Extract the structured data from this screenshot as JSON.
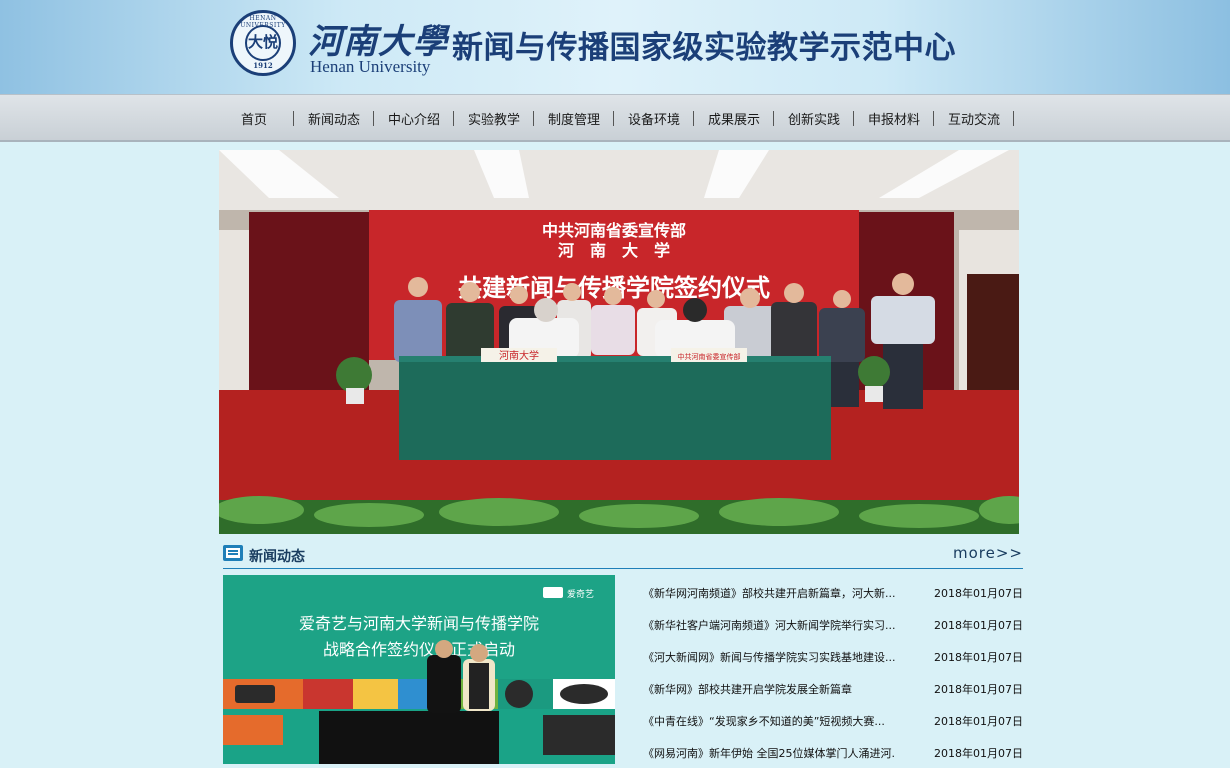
{
  "header": {
    "logo": {
      "seal_ring_text": "HENAN UNIVERSITY",
      "seal_mark": "大悦",
      "seal_year": "1912",
      "university_cn": "河南大學",
      "university_en": "Henan University"
    },
    "center_title": "新闻与传播国家级实验教学示范中心"
  },
  "nav": {
    "items": [
      {
        "label": "首页"
      },
      {
        "label": "新闻动态"
      },
      {
        "label": "中心介绍"
      },
      {
        "label": "实验教学"
      },
      {
        "label": "制度管理"
      },
      {
        "label": "设备环境"
      },
      {
        "label": "成果展示"
      },
      {
        "label": "创新实践"
      },
      {
        "label": "申报材料"
      },
      {
        "label": "互动交流"
      }
    ]
  },
  "hero": {
    "backdrop_line1": "中共河南省委宣传部",
    "backdrop_line2": "河　南　大　学",
    "backdrop_line3": "共建新闻与传播学院签约仪式",
    "table_sign_left": "河南大学",
    "table_sign_right": "中共河南省委宣传部"
  },
  "news": {
    "title": "新闻动态",
    "more": "more>>",
    "image": {
      "brand": "爱奇艺",
      "headline_line1": "爱奇艺与河南大学新闻与传播学院",
      "headline_line2": "战略合作签约仪式正式启动"
    },
    "items": [
      {
        "title": "《新华网河南频道》部校共建开启新篇章，河大新...",
        "date": "2018年01月07日"
      },
      {
        "title": "《新华社客户端河南频道》河大新闻学院举行实习...",
        "date": "2018年01月07日"
      },
      {
        "title": "《河大新闻网》新闻与传播学院实习实践基地建设...",
        "date": "2018年01月07日"
      },
      {
        "title": "《新华网》部校共建开启学院发展全新篇章",
        "date": "2018年01月07日"
      },
      {
        "title": "《中青在线》“发现家乡不知道的美”短视频大赛...",
        "date": "2018年01月07日"
      },
      {
        "title": "《网易河南》新年伊始 全国25位媒体掌门人涌进河...",
        "date": "2018年01月07日"
      }
    ]
  },
  "colors": {
    "page_bg": "#d9f1f7",
    "brand_blue": "#1b3f78",
    "accent_blue": "#1f7fb8",
    "backdrop_red": "#c8262a",
    "table_green": "#1d6b5a"
  }
}
